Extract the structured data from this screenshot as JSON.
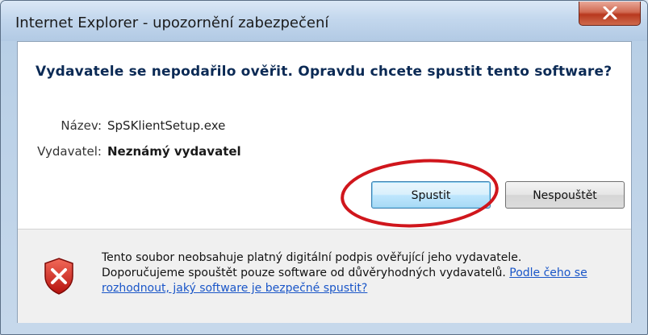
{
  "window": {
    "title": "Internet Explorer - upozornění zabezpečení"
  },
  "dialog": {
    "question": "Vydavatele se nepodařilo ověřit. Opravdu chcete spustit tento software?",
    "name_label": "Název:",
    "name_value": "SpSKlientSetup.exe",
    "publisher_label": "Vydavatel:",
    "publisher_value": "Neznámý vydavatel",
    "buttons": {
      "run_label": "Spustit",
      "dont_run_label": "Nespouštět"
    },
    "warning": {
      "text_part1": "Tento soubor neobsahuje platný digitální podpis ověřující jeho vydavatele.",
      "text_part2": "Doporučujeme spouštět pouze software od důvěryhodných vydavatelů.",
      "link_text": "Podle čeho se rozhodnout, jaký software je bezpečné spustit?"
    },
    "icons": {
      "close": "close-icon",
      "warning": "shield-x-icon"
    },
    "colors": {
      "question_text": "#0b2a55",
      "highlight_ellipse": "#d0161c",
      "link": "#1a56c8"
    }
  }
}
